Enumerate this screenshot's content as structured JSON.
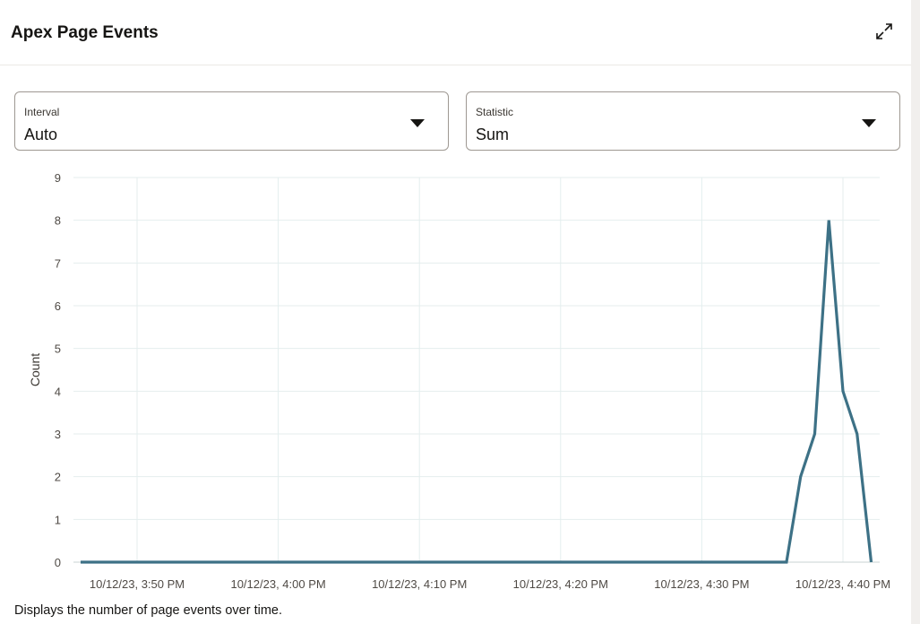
{
  "header": {
    "title": "Apex Page Events",
    "expand_icon": "expand-icon"
  },
  "filters": {
    "interval": {
      "label": "Interval",
      "value": "Auto"
    },
    "statistic": {
      "label": "Statistic",
      "value": "Sum"
    }
  },
  "chart_data": {
    "type": "line",
    "title": "",
    "xlabel": "",
    "ylabel": "Count",
    "ylim": [
      0,
      9
    ],
    "y_ticks": [
      "0",
      "1",
      "2",
      "3",
      "4",
      "5",
      "6",
      "7",
      "8",
      "9"
    ],
    "x_tick_labels": [
      "10/12/23, 3:50 PM",
      "10/12/23, 4:00 PM",
      "10/12/23, 4:10 PM",
      "10/12/23, 4:20 PM",
      "10/12/23, 4:30 PM",
      "10/12/23, 4:40 PM"
    ],
    "grid": true,
    "line_color": "#3d7186",
    "series": [
      {
        "x": [
          "3:46 PM",
          "4:36 PM",
          "4:37 PM",
          "4:38 PM",
          "4:39 PM",
          "4:40 PM",
          "4:41 PM",
          "4:42 PM"
        ],
        "values": [
          0,
          0,
          2,
          3,
          8,
          4,
          3,
          0
        ]
      }
    ]
  },
  "footer": {
    "description": "Displays the number of page events over time."
  }
}
